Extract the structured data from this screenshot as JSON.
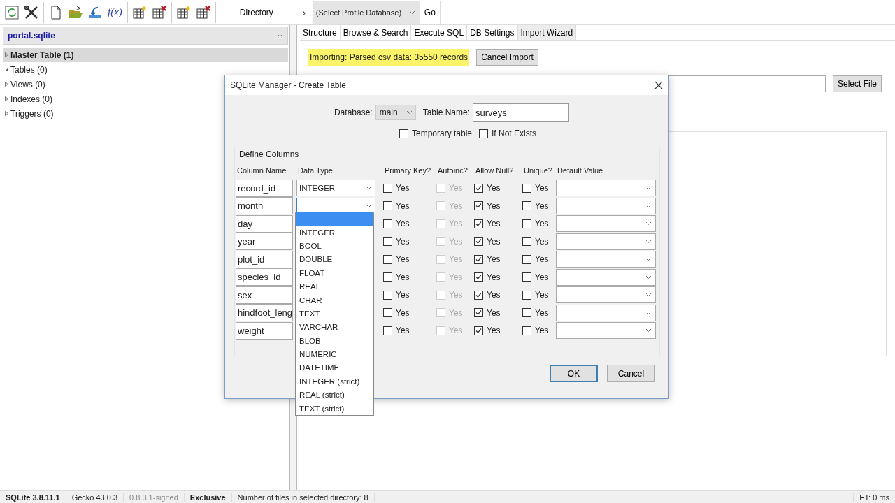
{
  "toolbar": {
    "function_button": "f(x)",
    "directory_button": "Directory",
    "directory_arrow": "›",
    "profile_select": "(Select Profile Database)",
    "go_button": "Go"
  },
  "database_select": "portal.sqlite",
  "tree": [
    {
      "label": "Master Table (1)",
      "expanded": false,
      "selected": true
    },
    {
      "label": "Tables (0)",
      "expanded": true,
      "selected": false
    },
    {
      "label": "Views (0)",
      "expanded": false,
      "selected": false
    },
    {
      "label": "Indexes (0)",
      "expanded": false,
      "selected": false
    },
    {
      "label": "Triggers (0)",
      "expanded": false,
      "selected": false
    }
  ],
  "tabs": [
    {
      "label": "Structure",
      "selected": false
    },
    {
      "label": "Browse & Search",
      "selected": false
    },
    {
      "label": "Execute SQL",
      "selected": false
    },
    {
      "label": "DB Settings",
      "selected": false
    },
    {
      "label": "Import Wizard",
      "selected": true
    }
  ],
  "import": {
    "status": "Importing: Parsed csv data: 35550 records",
    "cancel_button": "Cancel Import",
    "select_file_button": "Select File"
  },
  "dialog": {
    "title": "SQLite Manager - Create Table",
    "database_label": "Database:",
    "database_value": "main",
    "table_name_label": "Table Name:",
    "table_name_value": "surveys",
    "options": [
      {
        "label": "Temporary table",
        "checked": false
      },
      {
        "label": "If Not Exists",
        "checked": false
      }
    ],
    "group_title": "Define Columns",
    "headers": [
      "Column Name",
      "Data Type",
      "Primary Key?",
      "Autoinc?",
      "Allow Null?",
      "Unique?",
      "Default Value"
    ],
    "rows": [
      {
        "name": "record_id",
        "type": "INTEGER",
        "flags": [
          {
            "label": "Yes",
            "checked": false,
            "disabled": false
          },
          {
            "label": "Yes",
            "checked": false,
            "disabled": true
          },
          {
            "label": "Yes",
            "checked": true,
            "disabled": false
          },
          {
            "label": "Yes",
            "checked": false,
            "disabled": false
          }
        ]
      },
      {
        "name": "month",
        "open": true,
        "flags": [
          {
            "label": "Yes",
            "checked": false,
            "disabled": false
          },
          {
            "label": "Yes",
            "checked": false,
            "disabled": true
          },
          {
            "label": "Yes",
            "checked": true,
            "disabled": false
          },
          {
            "label": "Yes",
            "checked": false,
            "disabled": false
          }
        ]
      },
      {
        "name": "day",
        "flags": [
          {
            "label": "Yes",
            "checked": false,
            "disabled": false
          },
          {
            "label": "Yes",
            "checked": false,
            "disabled": true
          },
          {
            "label": "Yes",
            "checked": true,
            "disabled": false
          },
          {
            "label": "Yes",
            "checked": false,
            "disabled": false
          }
        ]
      },
      {
        "name": "year",
        "flags": [
          {
            "label": "Yes",
            "checked": false,
            "disabled": false
          },
          {
            "label": "Yes",
            "checked": false,
            "disabled": true
          },
          {
            "label": "Yes",
            "checked": true,
            "disabled": false
          },
          {
            "label": "Yes",
            "checked": false,
            "disabled": false
          }
        ]
      },
      {
        "name": "plot_id",
        "flags": [
          {
            "label": "Yes",
            "checked": false,
            "disabled": false
          },
          {
            "label": "Yes",
            "checked": false,
            "disabled": true
          },
          {
            "label": "Yes",
            "checked": true,
            "disabled": false
          },
          {
            "label": "Yes",
            "checked": false,
            "disabled": false
          }
        ]
      },
      {
        "name": "species_id",
        "flags": [
          {
            "label": "Yes",
            "checked": false,
            "disabled": false
          },
          {
            "label": "Yes",
            "checked": false,
            "disabled": true
          },
          {
            "label": "Yes",
            "checked": true,
            "disabled": false
          },
          {
            "label": "Yes",
            "checked": false,
            "disabled": false
          }
        ]
      },
      {
        "name": "sex",
        "flags": [
          {
            "label": "Yes",
            "checked": false,
            "disabled": false
          },
          {
            "label": "Yes",
            "checked": false,
            "disabled": true
          },
          {
            "label": "Yes",
            "checked": true,
            "disabled": false
          },
          {
            "label": "Yes",
            "checked": false,
            "disabled": false
          }
        ]
      },
      {
        "name": "hindfoot_leng",
        "flags": [
          {
            "label": "Yes",
            "checked": false,
            "disabled": false
          },
          {
            "label": "Yes",
            "checked": false,
            "disabled": true
          },
          {
            "label": "Yes",
            "checked": true,
            "disabled": false
          },
          {
            "label": "Yes",
            "checked": false,
            "disabled": false
          }
        ]
      },
      {
        "name": "weight",
        "flags": [
          {
            "label": "Yes",
            "checked": false,
            "disabled": false
          },
          {
            "label": "Yes",
            "checked": false,
            "disabled": true
          },
          {
            "label": "Yes",
            "checked": true,
            "disabled": false
          },
          {
            "label": "Yes",
            "checked": false,
            "disabled": false
          }
        ]
      }
    ],
    "type_options": [
      {
        "selected": true
      },
      {
        "label": "INTEGER",
        "selected": false
      },
      {
        "label": "BOOL",
        "selected": false
      },
      {
        "label": "DOUBLE",
        "selected": false
      },
      {
        "label": "FLOAT",
        "selected": false
      },
      {
        "label": "REAL",
        "selected": false
      },
      {
        "label": "CHAR",
        "selected": false
      },
      {
        "label": "TEXT",
        "selected": false
      },
      {
        "label": "VARCHAR",
        "selected": false
      },
      {
        "label": "BLOB",
        "selected": false
      },
      {
        "label": "NUMERIC",
        "selected": false
      },
      {
        "label": "DATETIME",
        "selected": false
      },
      {
        "label": "INTEGER (strict)",
        "selected": false
      },
      {
        "label": "REAL (strict)",
        "selected": false
      },
      {
        "label": "TEXT (strict)",
        "selected": false
      }
    ],
    "ok_button": "OK",
    "cancel_button": "Cancel"
  },
  "status_bar": [
    {
      "text": "SQLite 3.8.11.1",
      "kind": "bold"
    },
    {
      "text": "Gecko 43.0.3",
      "kind": "plain"
    },
    {
      "text": "0.8.3.1-signed",
      "kind": "muted"
    },
    {
      "text": "Exclusive",
      "kind": "bold"
    },
    {
      "text": "Number of files in selected directory: 8",
      "kind": "plain"
    }
  ],
  "status_right": "ET: 0 ms"
}
